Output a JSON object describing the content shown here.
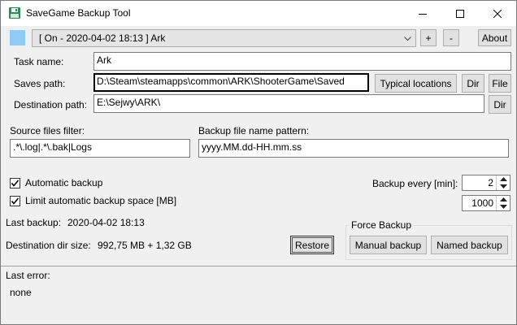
{
  "window": {
    "title": "SaveGame Backup Tool",
    "colors": {
      "title_bar": "#ffffff",
      "body": "#f0f0f0",
      "status_square": "#8ecbf5"
    }
  },
  "task_bar": {
    "selected_task": "[ On - 2020-04-02 18:13 ] Ark",
    "add_label": "+",
    "remove_label": "-",
    "about_label": "About"
  },
  "form": {
    "task_name_label": "Task name:",
    "task_name_value": "Ark",
    "saves_path_label": "Saves path:",
    "saves_path_value": "D:\\Steam\\steamapps\\common\\ARK\\ShooterGame\\Saved",
    "typical_locations_label": "Typical locations",
    "dir_label": "Dir",
    "file_label": "File",
    "destination_path_label": "Destination path:",
    "destination_path_value": "E:\\Sejwy\\ARK\\",
    "destination_dir_label": "Dir"
  },
  "filters": {
    "source_filter_label": "Source files filter:",
    "source_filter_value": ".*\\.log|.*\\.bak|Logs",
    "pattern_label": "Backup file name pattern:",
    "pattern_value": "yyyy.MM.dd-HH.mm.ss"
  },
  "options": {
    "automatic_backup_label": "Automatic backup",
    "automatic_backup_checked": true,
    "limit_space_label": "Limit automatic backup space [MB]",
    "limit_space_checked": true,
    "backup_every_label": "Backup every [min]:",
    "backup_every_value": "2",
    "limit_space_value": "1000"
  },
  "status": {
    "last_backup_label": "Last backup:",
    "last_backup_value": "2020-04-02 18:13",
    "dest_size_label": "Destination dir size:",
    "dest_size_value": "992,75 MB + 1,32 GB",
    "restore_label": "Restore"
  },
  "force_backup": {
    "group_label": "Force Backup",
    "manual_label": "Manual backup",
    "named_label": "Named backup"
  },
  "errors": {
    "last_error_label": "Last error:",
    "last_error_value": "none"
  }
}
